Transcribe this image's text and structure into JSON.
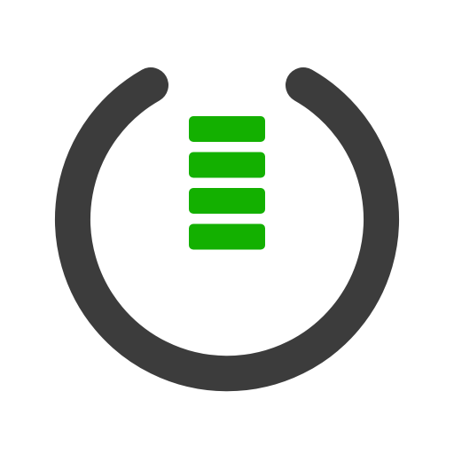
{
  "icon": {
    "name": "power-level-icon",
    "ring_color": "#3c3c3c",
    "bar_color": "#13b000",
    "level_bars_shown": 4
  }
}
